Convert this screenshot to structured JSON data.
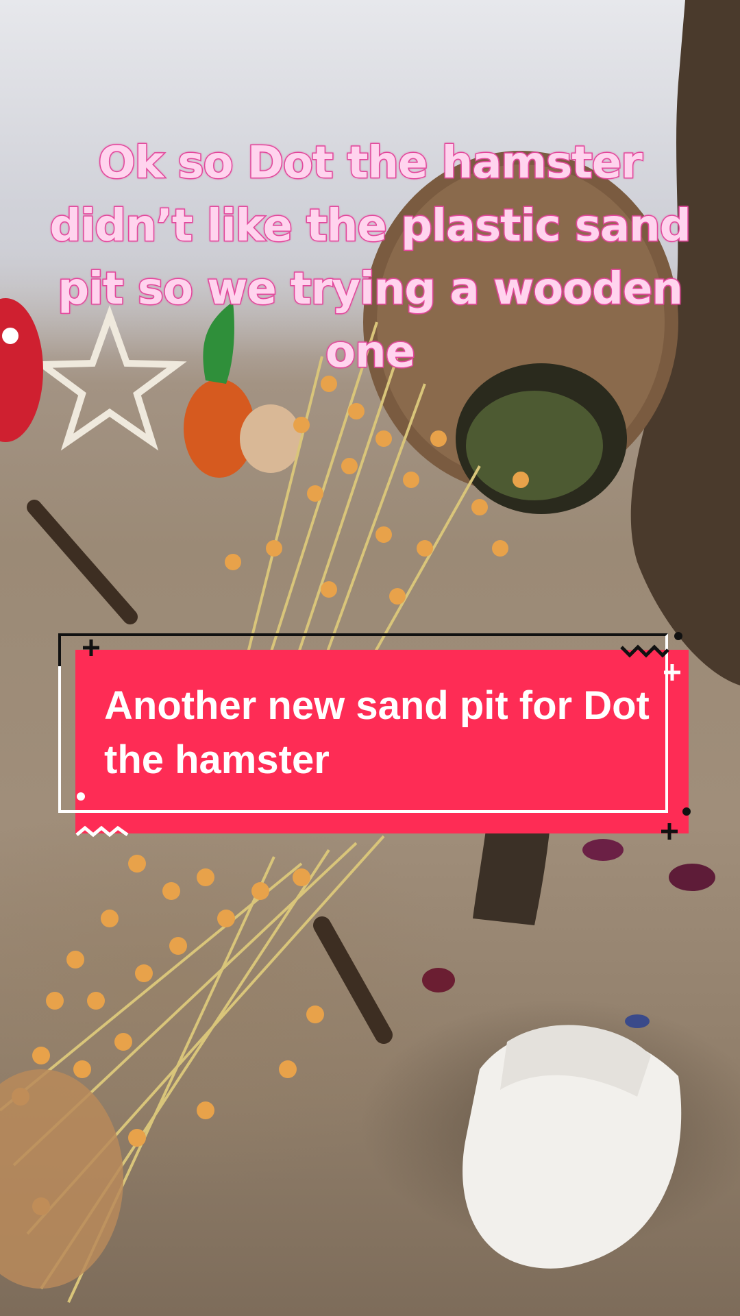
{
  "video": {
    "caption_overlay": "Ok so Dot the hamster didn’t like the plastic sand pit so we trying a wooden one",
    "title_banner": "Another new sand pit for Dot the hamster"
  },
  "colors": {
    "banner_background": "#fe2c55",
    "banner_text": "#ffffff",
    "caption_fill": "#ffd4ee",
    "caption_outline": "#e3489c"
  },
  "icons": {
    "banner_decorations": [
      "plus-icon",
      "zigzag-icon",
      "dot-icon"
    ]
  }
}
